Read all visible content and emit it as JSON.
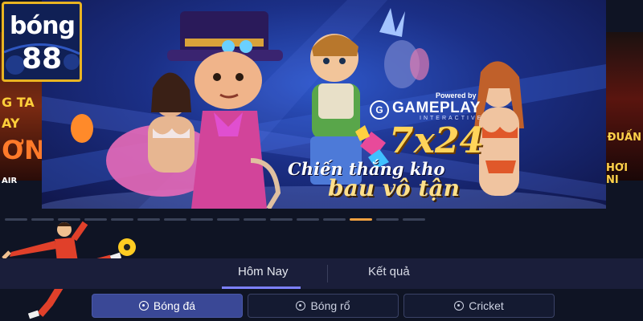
{
  "brand": {
    "logo_line1": "bóng",
    "logo_line2": "88"
  },
  "banner": {
    "powered_by": "Powered by",
    "provider": "GAMEPLAY",
    "provider_sub": "INTERACTIVE",
    "big_text": "7x24",
    "slogan_line1": "Chiến thắng kho",
    "slogan_line2": "bau vô tận"
  },
  "side_left": {
    "lines": [
      "G TA",
      "AY",
      "ƠN",
      "AIR"
    ]
  },
  "side_right": {
    "lines": [
      "ĐUẤN",
      "HƠI NI"
    ]
  },
  "carousel": {
    "slide_count": 16,
    "active_index": 13
  },
  "tabs": [
    {
      "label": "Hôm Nay",
      "active": true
    },
    {
      "label": "Kết quả",
      "active": false
    }
  ],
  "sports": [
    {
      "label": "Bóng đá",
      "icon": "soccer-ball-icon",
      "active": true
    },
    {
      "label": "Bóng rổ",
      "icon": "basketball-icon",
      "active": false
    },
    {
      "label": "Cricket",
      "icon": "cricket-ball-icon",
      "active": false
    }
  ],
  "colors": {
    "accent": "#7d80ff",
    "active_button": "#3a4896",
    "background": "#0f1424",
    "highlight_dot": "#f0a040"
  }
}
